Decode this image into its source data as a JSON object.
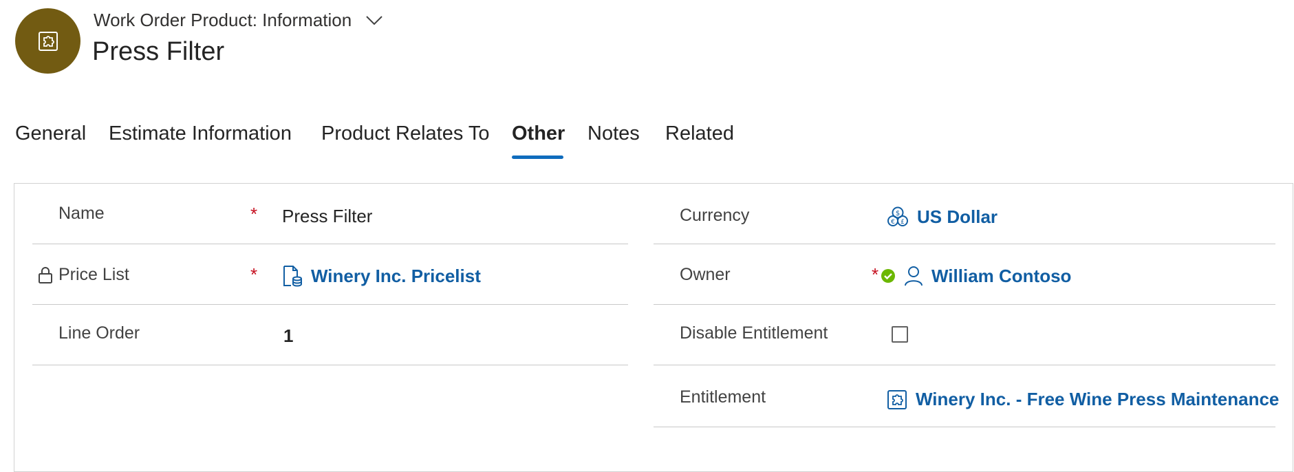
{
  "header": {
    "form_type": "Work Order Product: Information",
    "record_title": "Press Filter",
    "avatar_icon": "entitlement-puzzle-icon",
    "avatar_color": "#725b12"
  },
  "tabs": [
    {
      "label": "General"
    },
    {
      "label": "Estimate Information"
    },
    {
      "label": "Product Relates To"
    },
    {
      "label": "Other",
      "active": true
    },
    {
      "label": "Notes"
    },
    {
      "label": "Related"
    }
  ],
  "left_fields": {
    "name": {
      "label": "Name",
      "required": "*",
      "value": "Press Filter"
    },
    "price_list": {
      "label": "Price List",
      "required": "*",
      "value": "Winery Inc. Pricelist",
      "icon": "price-list-icon",
      "locked_icon": "lock-icon"
    },
    "line_order": {
      "label": "Line Order",
      "value": "1"
    }
  },
  "right_fields": {
    "currency": {
      "label": "Currency",
      "value": "US Dollar",
      "icon": "currency-icon"
    },
    "owner": {
      "label": "Owner",
      "required": "*",
      "value": "William Contoso",
      "status_icon": "available-presence-icon",
      "icon": "person-icon"
    },
    "disable_entitlement": {
      "label": "Disable Entitlement",
      "checked": false
    },
    "entitlement": {
      "label": "Entitlement",
      "value": "Winery Inc. - Free Wine Press Maintenance",
      "icon": "entitlement-icon"
    }
  },
  "colors": {
    "accent": "#0f6cbd",
    "link": "#115ea3",
    "required": "#c50f1f",
    "presence_available": "#6bb700"
  }
}
